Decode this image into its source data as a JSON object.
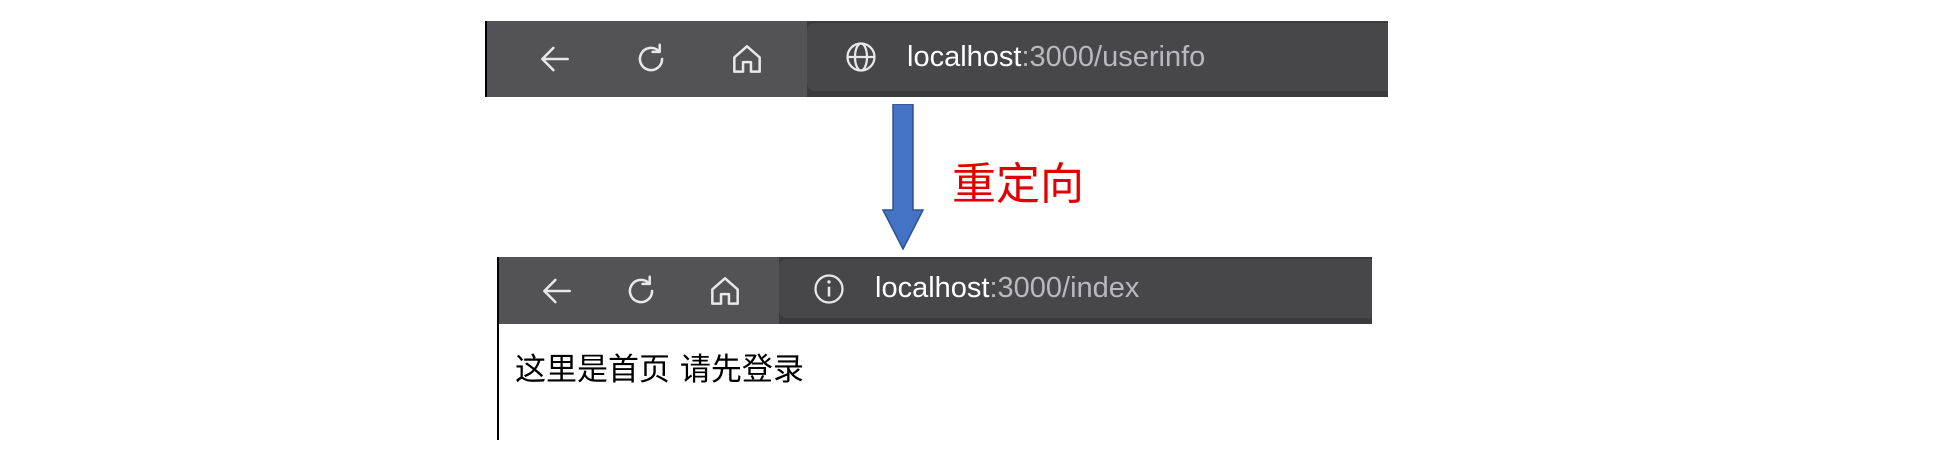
{
  "before": {
    "url_host": "localhost",
    "url_path": ":3000/userinfo",
    "icons": {
      "back": "back-arrow-icon",
      "refresh": "refresh-icon",
      "home": "home-icon",
      "site": "globe-icon"
    }
  },
  "redirect_label": "重定向",
  "after": {
    "url_host": "localhost",
    "url_path": ":3000/index",
    "icons": {
      "back": "back-arrow-icon",
      "refresh": "refresh-icon",
      "home": "home-icon",
      "site": "info-icon"
    },
    "page_text": "这里是首页 请先登录"
  },
  "colors": {
    "toolbar": "#3b3b3d",
    "nav_area": "#535356",
    "address_bar": "#47474a",
    "arrow_fill": "#4472c4",
    "label": "#e00000"
  }
}
